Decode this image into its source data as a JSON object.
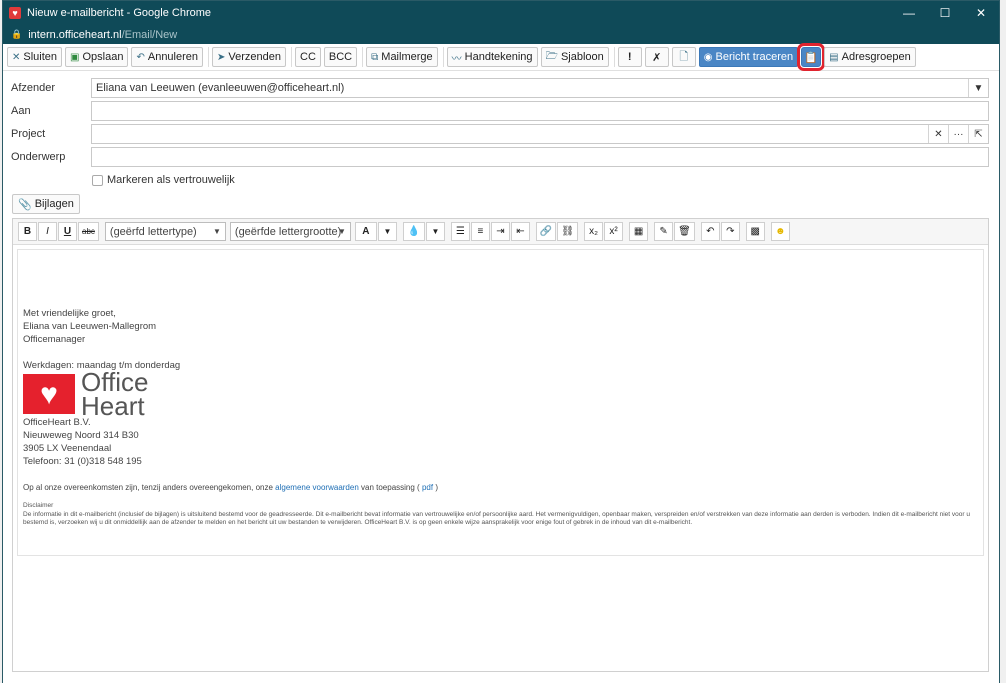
{
  "window": {
    "title": "Nieuw e-mailbericht - Google Chrome",
    "favicon": "heart-icon",
    "controls": [
      "—",
      "☐",
      "✕"
    ]
  },
  "address": {
    "host": "intern.officeheart.nl",
    "path": "/Email/New"
  },
  "toolbar": {
    "sluiten": "Sluiten",
    "opslaan": "Opslaan",
    "annuleren": "Annuleren",
    "verzenden": "Verzenden",
    "cc": "CC",
    "bcc": "BCC",
    "mailmerge": "Mailmerge",
    "handtekening": "Handtekening",
    "sjabloon": "Sjabloon",
    "bericht_traceren": "Bericht traceren",
    "adresgroepen": "Adresgroepen"
  },
  "form": {
    "afzender_label": "Afzender",
    "afzender_value": "Eliana van Leeuwen (evanleeuwen@officeheart.nl)",
    "aan_label": "Aan",
    "aan_value": "",
    "project_label": "Project",
    "project_value": "",
    "onderwerp_label": "Onderwerp",
    "onderwerp_value": "",
    "vertrouwelijk_label": "Markeren als vertrouwelijk",
    "bijlagen_label": "Bijlagen"
  },
  "editor": {
    "font_select": "(geërfd lettertype)",
    "size_select": "(geërfde lettergrootte)",
    "buttons": {
      "bold": "B",
      "italic": "I",
      "underline": "U",
      "strike": "abc",
      "text_color": "A",
      "sub": "x₂",
      "sup": "x²"
    }
  },
  "signature": {
    "greeting": "Met vriendelijke groet,",
    "name": "Eliana van Leeuwen-Mallegrom",
    "role": "Officemanager",
    "workdays": "Werkdagen: maandag t/m donderdag",
    "logo_line1": "Office",
    "logo_line2": "Heart",
    "company": "OfficeHeart B.V.",
    "street": "Nieuweweg Noord 314 B30",
    "city": "3905 LX Veenendaal",
    "phone": "Telefoon: 31 (0)318 548 195",
    "terms_pre": "Op al onze overeenkomsten zijn, tenzij anders overeengekomen, onze",
    "terms_link": "algemene voorwaarden",
    "terms_mid": "van toepassing (",
    "terms_pdf": "pdf",
    "terms_post": ")",
    "disclaimer_title": "Disclaimer",
    "disclaimer_text": "De informatie in dit e-mailbericht (inclusief de bijlagen) is uitsluitend bestemd voor de geadresseerde. Dit e-mailbericht bevat informatie van vertrouwelijke en/of persoonlijke aard. Het vermenigvuldigen, openbaar maken, verspreiden en/of verstrekken van deze informatie aan derden is verboden. Indien dit e-mailbericht niet voor u bestemd is, verzoeken wij u dit onmiddellijk aan de afzender te melden en het bericht uit uw bestanden te verwijderen. OfficeHeart B.V. is op geen enkele wijze aansprakelijk voor enige fout of gebrek in de inhoud van dit e-mailbericht."
  },
  "colors": {
    "titlebar": "#0f4a58",
    "primary": "#4a86c5",
    "highlight": "#e0242f",
    "brand_red": "#e5212d"
  }
}
